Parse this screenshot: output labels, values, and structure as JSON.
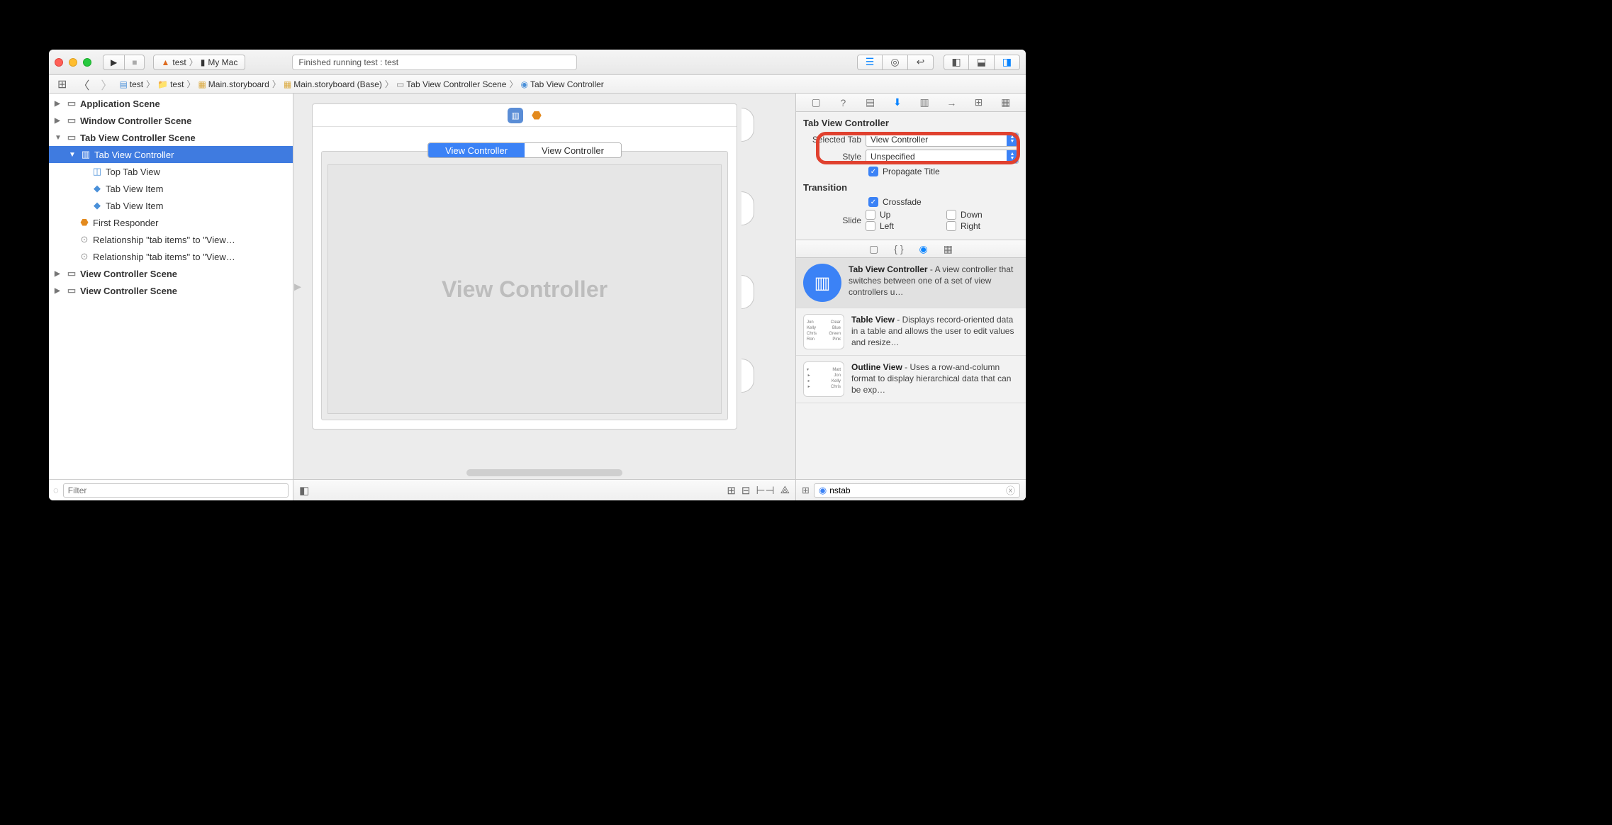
{
  "toolbar": {
    "scheme": "test",
    "device": "My Mac",
    "status": "Finished running test : test"
  },
  "breadcrumb": {
    "items": [
      "test",
      "test",
      "Main.storyboard",
      "Main.storyboard (Base)",
      "Tab View Controller Scene",
      "Tab View Controller"
    ]
  },
  "outline": {
    "scenes": {
      "app": "Application Scene",
      "window": "Window Controller Scene",
      "tabvc": "Tab View Controller Scene",
      "vc1": "View Controller Scene",
      "vc2": "View Controller Scene"
    },
    "tabvc_children": {
      "root": "Tab View Controller",
      "toptab": "Top Tab View",
      "item1": "Tab View Item",
      "item2": "Tab View Item",
      "first_responder": "First Responder",
      "rel1": "Relationship \"tab items\" to \"View…",
      "rel2": "Relationship \"tab items\" to \"View…"
    },
    "filter_placeholder": "Filter"
  },
  "canvas": {
    "tab1": "View Controller",
    "tab2": "View Controller",
    "placeholder": "View Controller"
  },
  "inspector": {
    "title": "Tab View Controller",
    "selected_tab_label": "Selected Tab",
    "selected_tab_value": "View Controller",
    "style_label": "Style",
    "style_value": "Unspecified",
    "propagate_title": "Propagate Title",
    "transition_label": "Transition",
    "crossfade": "Crossfade",
    "slide_label": "Slide",
    "dirs": {
      "up": "Up",
      "down": "Down",
      "left": "Left",
      "right": "Right"
    }
  },
  "library": {
    "items": [
      {
        "title": "Tab View Controller",
        "desc": " - A view controller that switches between one of a set of view controllers u…"
      },
      {
        "title": "Table View",
        "desc": " - Displays record-oriented data in a table and allows the user to edit values and resize…"
      },
      {
        "title": "Outline View",
        "desc": " - Uses a row-and-column format to display hierarchical data that can be exp…"
      }
    ],
    "filter_value": "nstab"
  },
  "mini_table": {
    "rows": [
      [
        "Jon",
        "Clear"
      ],
      [
        "Kelly",
        "Blue"
      ],
      [
        "Chris",
        "Green"
      ],
      [
        "Ron",
        "Pink"
      ]
    ]
  },
  "mini_outline": [
    "Matt",
    "Jon",
    "Kelly",
    "Chris"
  ]
}
